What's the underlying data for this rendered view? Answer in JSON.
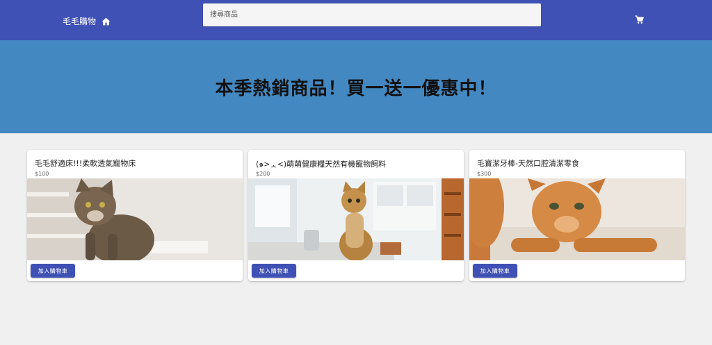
{
  "header": {
    "brand": "毛毛購物",
    "home_icon": "home-icon",
    "cart_icon": "shopping-cart-icon",
    "search": {
      "placeholder": "搜尋商品",
      "value": ""
    }
  },
  "hero": {
    "title": "本季熱銷商品！買一送一優惠中！"
  },
  "products": [
    {
      "title": "毛毛舒適床!!!柔軟透氣寵物床",
      "price": "$100",
      "button": "加入購物車"
    },
    {
      "title": "(๑>ᆺ<)萌萌健康糧天然有機寵物飼料",
      "price": "$200",
      "button": "加入購物車"
    },
    {
      "title": "毛寶潔牙棒-天然口腔清潔零食",
      "price": "$300",
      "button": "加入購物車"
    }
  ],
  "colors": {
    "appbar": "#3f51b5",
    "hero": "#4388c1",
    "background": "#f0f0f0",
    "button": "#3f51b5"
  }
}
